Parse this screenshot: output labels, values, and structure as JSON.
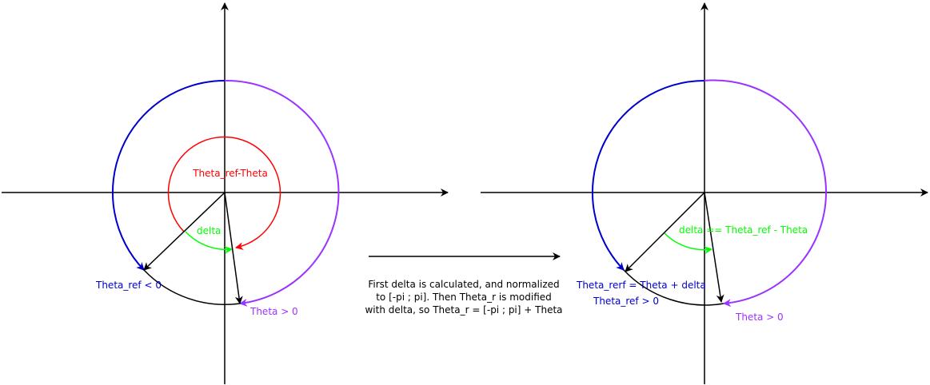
{
  "colors": {
    "axis": "#000000",
    "red": "#ff0000",
    "green": "#00ff00",
    "blue": "#0000cc",
    "purple": "#9933ff",
    "black": "#000000"
  },
  "left": {
    "red_label": "Theta_ref-Theta",
    "green_label": "delta",
    "blue_label": "Theta_ref < 0",
    "purple_label": "Theta > 0"
  },
  "right": {
    "green_label": "delta == Theta_ref - Theta",
    "blue_label_1": "Theta_rerf = Theta + delta",
    "blue_label_2": "Theta_ref > 0",
    "purple_label": "Theta > 0"
  },
  "caption": {
    "line1": "First delta is calculated, and normalized",
    "line2": "to [-pi ; pi]. Then Theta_r is modified",
    "line3": "with delta, so Theta_r = [-pi ; pi] + Theta"
  }
}
